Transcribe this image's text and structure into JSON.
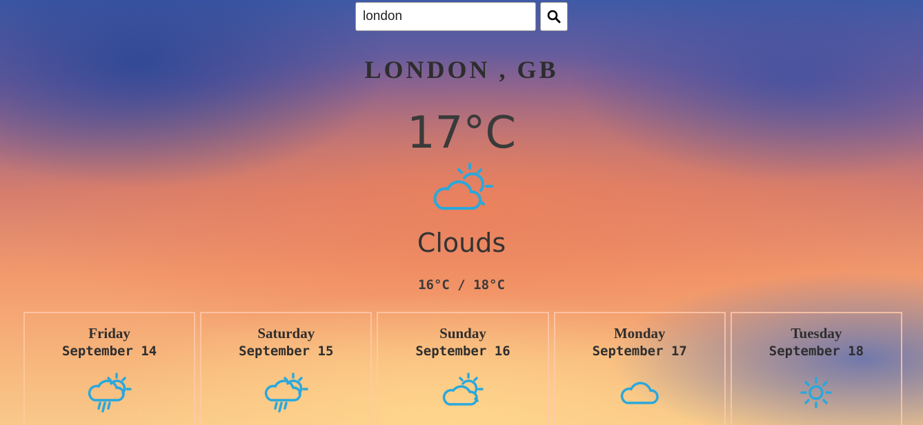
{
  "search": {
    "value": "london",
    "icon": "search-icon"
  },
  "current": {
    "location": "LONDON , GB",
    "temperature": "17°C",
    "condition": "Clouds",
    "icon": "partly-cloudy-icon",
    "min_max": "16°C / 18°C"
  },
  "forecast": [
    {
      "day": "Friday",
      "date": "September 14",
      "icon": "rain-sun-icon"
    },
    {
      "day": "Saturday",
      "date": "September 15",
      "icon": "rain-sun-icon"
    },
    {
      "day": "Sunday",
      "date": "September 16",
      "icon": "partly-cloudy-icon"
    },
    {
      "day": "Monday",
      "date": "September 17",
      "icon": "cloud-icon"
    },
    {
      "day": "Tuesday",
      "date": "September 18",
      "icon": "sun-icon"
    }
  ],
  "colors": {
    "icon": "#29a8dc"
  }
}
